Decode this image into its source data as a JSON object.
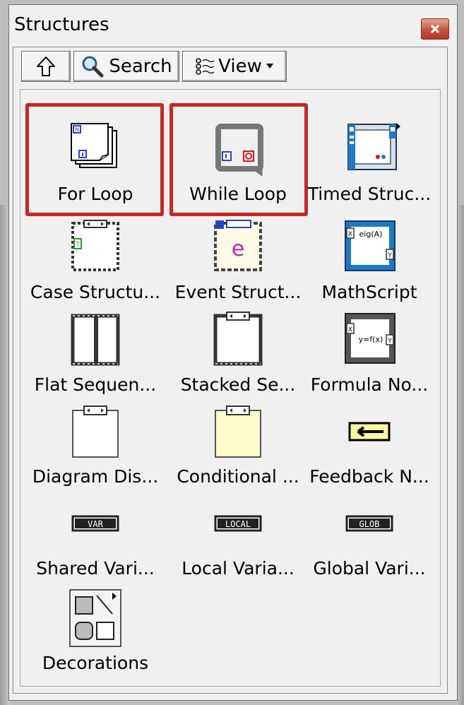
{
  "window": {
    "title": "Structures",
    "close_icon": "close-icon"
  },
  "toolbar": {
    "up_icon": "up-arrow-icon",
    "search_label": "Search",
    "view_label": "View",
    "view_icon": "view-list-icon",
    "view_dropdown_icon": "dropdown-arrow-icon"
  },
  "items": [
    {
      "label": "For Loop",
      "icon": "for-loop-icon",
      "highlighted": true
    },
    {
      "label": "While Loop",
      "icon": "while-loop-icon",
      "highlighted": true
    },
    {
      "label": "Timed Struc...",
      "icon": "timed-structure-icon"
    },
    {
      "label": "Case Structu...",
      "icon": "case-structure-icon"
    },
    {
      "label": "Event Struct...",
      "icon": "event-structure-icon"
    },
    {
      "label": "MathScript",
      "icon": "mathscript-icon"
    },
    {
      "label": "Flat Sequen...",
      "icon": "flat-sequence-icon"
    },
    {
      "label": "Stacked Se...",
      "icon": "stacked-sequence-icon"
    },
    {
      "label": "Formula No...",
      "icon": "formula-node-icon"
    },
    {
      "label": "Diagram Dis...",
      "icon": "diagram-disable-icon"
    },
    {
      "label": "Conditional ...",
      "icon": "conditional-disable-icon"
    },
    {
      "label": "Feedback N...",
      "icon": "feedback-node-icon"
    },
    {
      "label": "Shared Vari...",
      "icon": "shared-variable-icon",
      "glyph_text": "VAR"
    },
    {
      "label": "Local Varia...",
      "icon": "local-variable-icon",
      "glyph_text": "LOCAL"
    },
    {
      "label": "Global Vari...",
      "icon": "global-variable-icon",
      "glyph_text": "GLOB"
    },
    {
      "label": "Decorations",
      "icon": "decorations-icon"
    }
  ],
  "glyph_text": {
    "mathscript": "eig(A)",
    "formula": "y=f(x)"
  },
  "colors": {
    "highlight": "#c8281f",
    "mathscript_blue": "#1e78c8"
  }
}
